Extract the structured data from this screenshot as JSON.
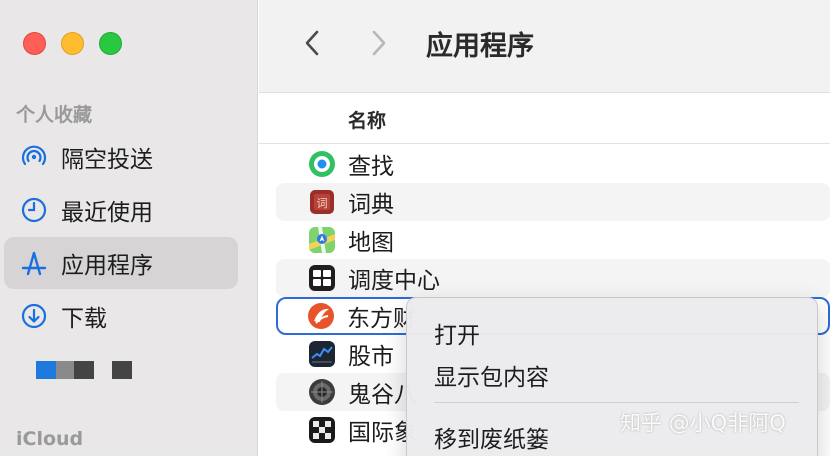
{
  "sidebar": {
    "favorites_label": "个人收藏",
    "items": [
      {
        "label": "隔空投送",
        "icon": "airdrop-icon",
        "selected": false
      },
      {
        "label": "最近使用",
        "icon": "clock-icon",
        "selected": false
      },
      {
        "label": "应用程序",
        "icon": "applications-icon",
        "selected": true
      },
      {
        "label": "下载",
        "icon": "download-icon",
        "selected": false
      }
    ],
    "icloud_label": "iCloud"
  },
  "toolbar": {
    "title": "应用程序"
  },
  "list": {
    "column_name": "名称",
    "rows": [
      {
        "name": "查找",
        "icon": "find-my-icon"
      },
      {
        "name": "词典",
        "icon": "dictionary-icon"
      },
      {
        "name": "地图",
        "icon": "maps-icon"
      },
      {
        "name": "调度中心",
        "icon": "mission-control-icon"
      },
      {
        "name": "东方财",
        "icon": "eastmoney-icon"
      },
      {
        "name": "股市",
        "icon": "stocks-icon"
      },
      {
        "name": "鬼谷八",
        "icon": "guigu-icon"
      },
      {
        "name": "国际象",
        "icon": "chess-icon"
      }
    ]
  },
  "context_menu": {
    "items": [
      "打开",
      "显示包内容",
      "移到废纸篓"
    ]
  },
  "watermark": "知乎 @小Q非阿Q",
  "colors": {
    "sidebar_bg": "#e9e7e8",
    "selection": "#d6d4d5",
    "focus_ring": "#2e6bd8",
    "accent": "#1a6fe0"
  }
}
